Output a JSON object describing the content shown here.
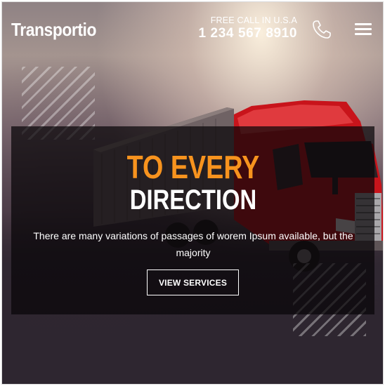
{
  "header": {
    "logo_text": "Transportio",
    "call_label": "FREE CALL IN U.S.A",
    "phone_number": "1 234 567 8910",
    "phone_icon": "phone-icon",
    "menu_icon": "hamburger-menu-icon"
  },
  "hero": {
    "title_line1": "TO EVERY",
    "title_line2": "DIRECTION",
    "description": "There are many variations of passages of worem Ipsum available, but the majority",
    "button_label": "VIEW SERVICES",
    "colors": {
      "accent": "#f7931e",
      "overlay": "rgba(8,6,8,0.72)",
      "truck_cab": "#c8141b",
      "text": "#ffffff"
    }
  }
}
